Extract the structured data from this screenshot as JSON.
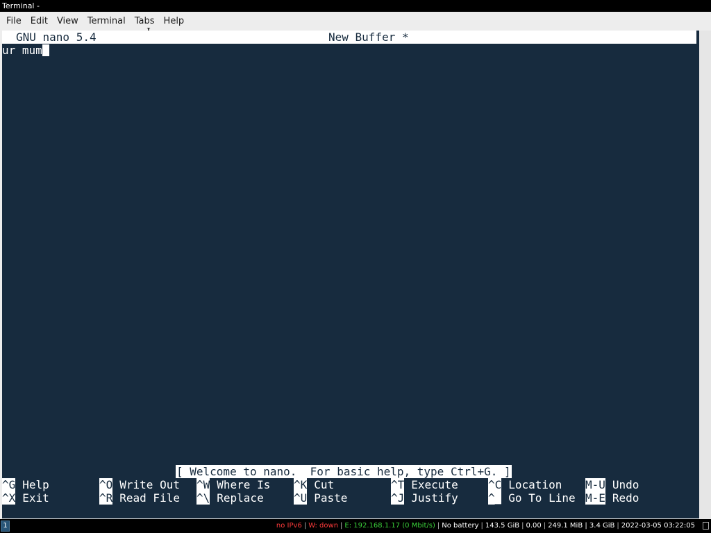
{
  "window": {
    "title": "Terminal -"
  },
  "menubar": {
    "items": [
      "File",
      "Edit",
      "View",
      "Terminal",
      "Tabs",
      "Help"
    ]
  },
  "nano": {
    "version": "GNU nano 5.4",
    "filename": "New Buffer *",
    "buffer_text": "ur mum",
    "status_message": "[ Welcome to nano.  For basic help, type Ctrl+G. ]",
    "shortcuts": [
      {
        "key": "^G",
        "label": "Help"
      },
      {
        "key": "^O",
        "label": "Write Out"
      },
      {
        "key": "^W",
        "label": "Where Is"
      },
      {
        "key": "^K",
        "label": "Cut"
      },
      {
        "key": "^T",
        "label": "Execute"
      },
      {
        "key": "^C",
        "label": "Location"
      },
      {
        "key": "M-U",
        "label": "Undo"
      },
      {
        "key": "^X",
        "label": "Exit"
      },
      {
        "key": "^R",
        "label": "Read File"
      },
      {
        "key": "^\\",
        "label": "Replace"
      },
      {
        "key": "^U",
        "label": "Paste"
      },
      {
        "key": "^J",
        "label": "Justify"
      },
      {
        "key": "^_",
        "label": "Go To Line"
      },
      {
        "key": "M-E",
        "label": "Redo"
      }
    ]
  },
  "taskbar": {
    "workspace": "1",
    "status": [
      {
        "text": "no IPv6",
        "color": "#ff3b3b"
      },
      {
        "text": "W: down",
        "color": "#ff3b3b"
      },
      {
        "text": "E: 192.168.1.17 (0 Mbit/s)",
        "color": "#3bd13b"
      },
      {
        "text": "No battery",
        "color": "#ffffff"
      },
      {
        "text": "143.5 GiB",
        "color": "#ffffff"
      },
      {
        "text": "0.00",
        "color": "#ffffff"
      },
      {
        "text": "249.1 MiB | 3.4 GiB",
        "color": "#ffffff"
      },
      {
        "text": "2022-03-05 03:22:05",
        "color": "#ffffff"
      }
    ]
  },
  "colors": {
    "terminal_bg": "#172b3e",
    "terminal_fg": "#ffffff",
    "workspace_active": "#285577"
  }
}
